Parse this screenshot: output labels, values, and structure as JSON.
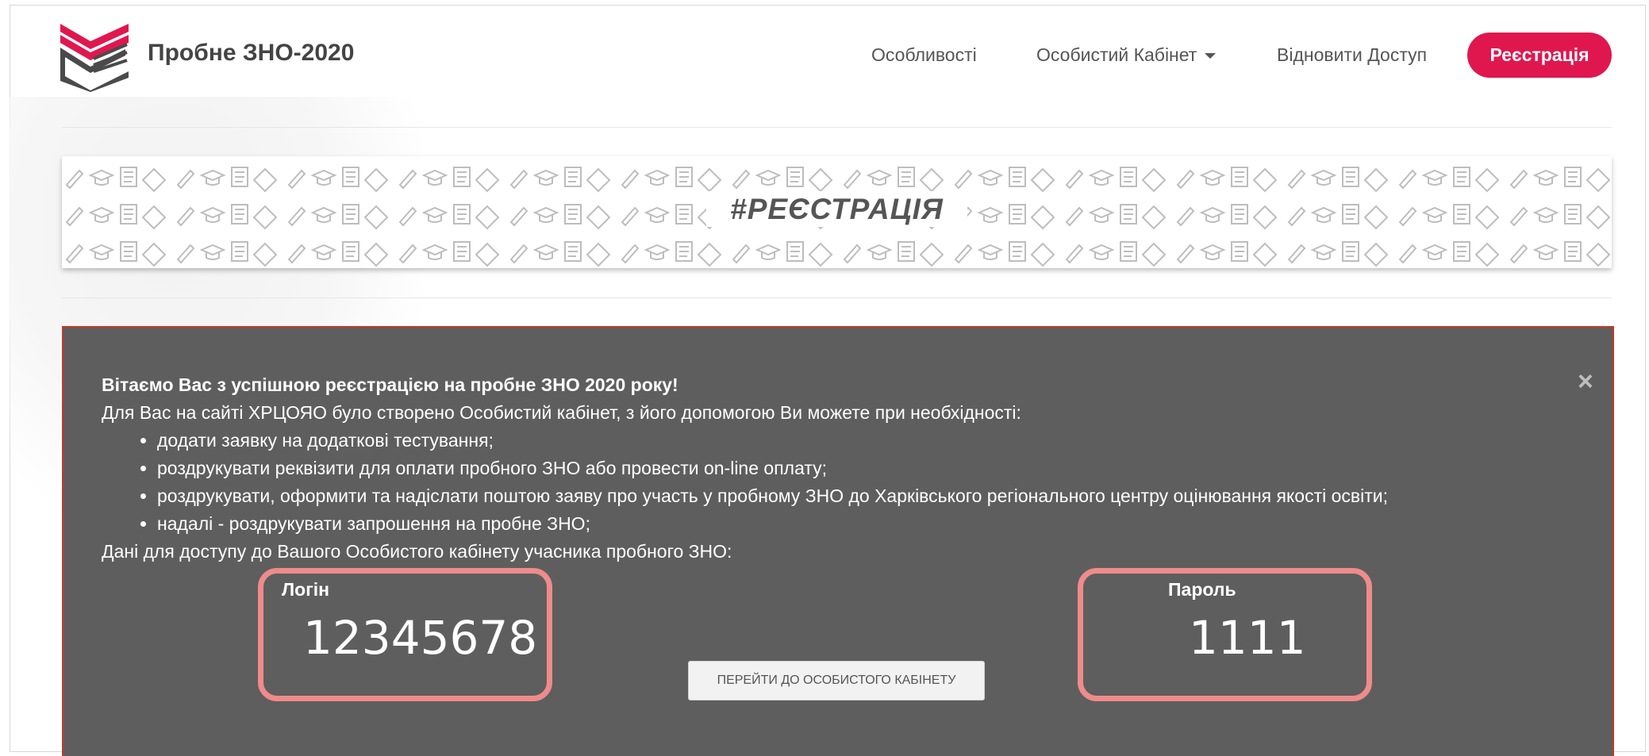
{
  "header": {
    "brand": "Пробне ЗНО-2020",
    "nav": {
      "features": "Особливості",
      "cabinet": "Особистий Кабінет",
      "restore": "Відновити Доступ",
      "register": "Реєстрація"
    }
  },
  "banner": {
    "title": "#РЕЄСТРАЦІЯ"
  },
  "alert": {
    "heading": "Вітаємо Вас з успішною реєстрацією на пробне ЗНО 2020 року!",
    "intro": "Для Вас на сайті ХРЦОЯО було створено Особистий кабінет, з його допомогою Ви можете при необхідності:",
    "items": [
      "додати заявку на додаткові тестування;",
      "роздрукувати реквізити для оплати пробного ЗНО або провести on-line оплату;",
      "роздрукувати, оформити та надіслати поштою заяву про участь у пробному ЗНО до Харківського регіонального центру оцінювання якості освіти;",
      "надалі - роздрукувати запрошення на пробне ЗНО;"
    ],
    "access_text": "Дані для доступу до Вашого Особистого кабінету учасника пробного ЗНО:",
    "close": "×",
    "login_label": "Логін",
    "login_value": "12345678",
    "password_label": "Пароль",
    "password_value": "1111",
    "goto_button": "Перейти до особистого кабінету"
  },
  "colors": {
    "accent": "#e0174f",
    "panel": "#5e5e5e",
    "highlight": "#ef8b8b"
  }
}
